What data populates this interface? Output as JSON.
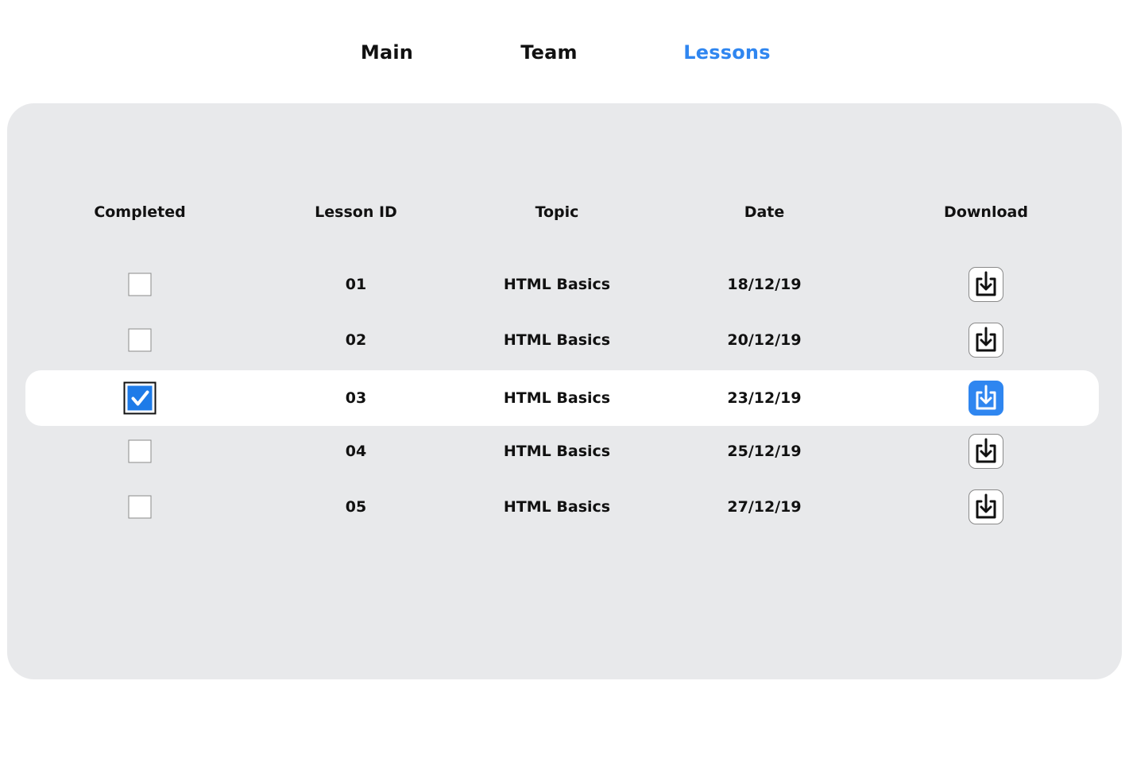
{
  "nav": {
    "items": [
      {
        "label": "Main",
        "active": false
      },
      {
        "label": "Team",
        "active": false
      },
      {
        "label": "Lessons",
        "active": true
      }
    ],
    "accent_color": "#2f86f0"
  },
  "table": {
    "headers": [
      "Completed",
      "Lesson ID",
      "Topic",
      "Date",
      "Download"
    ],
    "rows": [
      {
        "completed": false,
        "id": "01",
        "topic": "HTML Basics",
        "date": "18/12/19",
        "download_icon": "download-icon"
      },
      {
        "completed": false,
        "id": "02",
        "topic": "HTML Basics",
        "date": "20/12/19",
        "download_icon": "download-icon"
      },
      {
        "completed": true,
        "id": "03",
        "topic": "HTML Basics",
        "date": "23/12/19",
        "download_icon": "download-icon"
      },
      {
        "completed": false,
        "id": "04",
        "topic": "HTML Basics",
        "date": "25/12/19",
        "download_icon": "download-icon"
      },
      {
        "completed": false,
        "id": "05",
        "topic": "HTML Basics",
        "date": "27/12/19",
        "download_icon": "download-icon"
      }
    ]
  }
}
